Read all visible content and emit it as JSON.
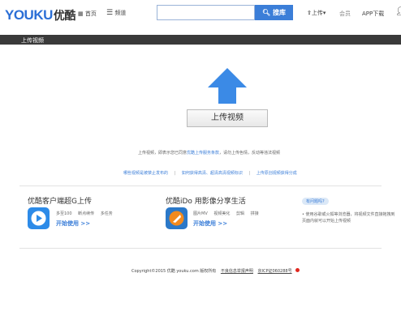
{
  "header": {
    "logo_youku": "YOUKU",
    "logo_cn": "优酷",
    "nav_home": "首页",
    "nav_channel": "频道",
    "search_placeholder": "",
    "search_button": "搜库",
    "upload": "上传",
    "membership": "会员",
    "app_download": "APP下载"
  },
  "section_bar": {
    "title": "上传视频"
  },
  "upload": {
    "button_label": "上传视频",
    "notice_prefix": "上传视频，即表示您已同意",
    "notice_link": "优酷上传服务条款",
    "notice_suffix": "，请勿上传色情，反动等违法视频",
    "links": [
      "哪些视频是被禁止发布的",
      "如何获得高清、超清高清视频标识",
      "上传原创视频获得分成"
    ],
    "separator": "|"
  },
  "client": {
    "title": "优酷客户端超G上传",
    "features": [
      "多至100",
      "断点续传",
      "多任务"
    ],
    "start_label": "开始使用 >>"
  },
  "ido": {
    "title": "优酷iDo 用影像分享生活",
    "features": [
      "图片MV",
      "视频美化",
      "剪辑",
      "拼接"
    ],
    "start_label": "开始使用 >>"
  },
  "tip": {
    "bubble": "有问题吗?",
    "text": "• 使用谷歌或火狐等浏览器，将视频文件直接拖拽到页面内就可以开始上传视频"
  },
  "footer": {
    "copyright": "Copyright©2015 优酷 youku.com 版权所有",
    "link1": "不良信息举报声明",
    "link2": "京ICP证060288号"
  },
  "colors": {
    "accent": "#3b7ed8",
    "brand_red": "#e0281f",
    "dark_bar": "#3a3a3a"
  }
}
